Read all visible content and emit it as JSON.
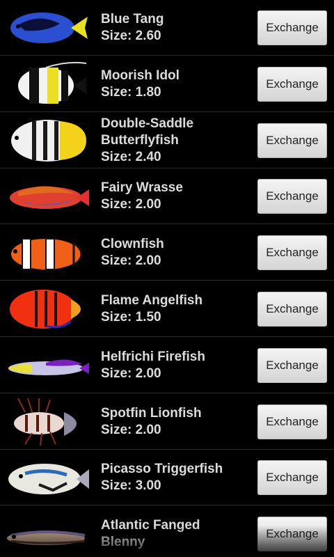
{
  "fish_list": [
    {
      "name": "Blue Tang",
      "size": "Size: 2.60",
      "icon": "blue-tang-icon",
      "button": "Exchange",
      "body": "#2a4fd0",
      "accent": "#e8e020",
      "stripe": "#0b0f3a"
    },
    {
      "name": "Moorish Idol",
      "size": "Size: 1.80",
      "icon": "moorish-idol-icon",
      "button": "Exchange",
      "body": "#f2f2f2",
      "accent": "#e8e020",
      "stripe": "#111111"
    },
    {
      "name": "Double-Saddle Butterflyfish",
      "size": "Size: 2.40",
      "icon": "butterflyfish-icon",
      "button": "Exchange",
      "body": "#f0f0f0",
      "accent": "#f2d21a",
      "stripe": "#1a1a1a"
    },
    {
      "name": "Fairy Wrasse",
      "size": "Size: 2.00",
      "icon": "fairy-wrasse-icon",
      "button": "Exchange",
      "body": "#e04030",
      "accent": "#4c5cc8",
      "stripe": "#e06a20"
    },
    {
      "name": "Clownfish",
      "size": "Size: 2.00",
      "icon": "clownfish-icon",
      "button": "Exchange",
      "body": "#f06018",
      "accent": "#ffffff",
      "stripe": "#111111"
    },
    {
      "name": "Flame Angelfish",
      "size": "Size: 1.50",
      "icon": "flame-angelfish-icon",
      "button": "Exchange",
      "body": "#f03010",
      "accent": "#2a2ab0",
      "stripe": "#1a0a0a"
    },
    {
      "name": "Helfrichi Firefish",
      "size": "Size: 2.00",
      "icon": "firefish-icon",
      "button": "Exchange",
      "body": "#c8c4e8",
      "accent": "#7a20c0",
      "stripe": "#e8e040"
    },
    {
      "name": "Spotfin Lionfish",
      "size": "Size: 2.00",
      "icon": "lionfish-icon",
      "button": "Exchange",
      "body": "#e8d8d0",
      "accent": "#8a2a1a",
      "stripe": "#5a1a10"
    },
    {
      "name": "Picasso Triggerfish",
      "size": "Size: 3.00",
      "icon": "triggerfish-icon",
      "button": "Exchange",
      "body": "#e8e8e0",
      "accent": "#2a6ab8",
      "stripe": "#1a1a1a"
    },
    {
      "name": "Atlantic Fanged Blenny",
      "size": "",
      "icon": "blenny-icon",
      "button": "Exchange",
      "body": "#c8a890",
      "accent": "#7a6a9a",
      "stripe": "#5a3a30"
    }
  ]
}
